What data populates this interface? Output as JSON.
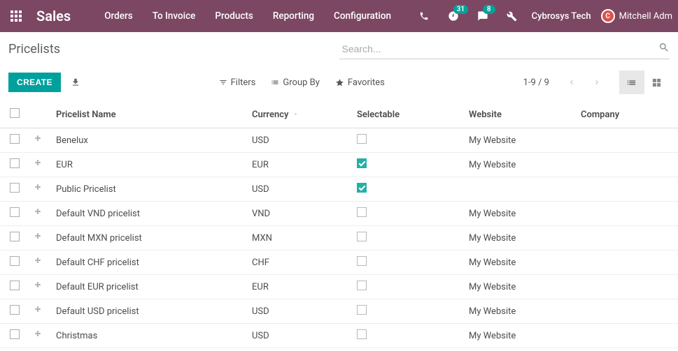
{
  "nav": {
    "brand": "Sales",
    "links": [
      "Orders",
      "To Invoice",
      "Products",
      "Reporting",
      "Configuration"
    ],
    "clock_badge": "31",
    "chat_badge": "8",
    "company": "Cybrosys Tech",
    "user": "Mitchell Adm"
  },
  "breadcrumb": "Pricelists",
  "search": {
    "placeholder": "Search..."
  },
  "buttons": {
    "create": "CREATE"
  },
  "filters": {
    "filters": "Filters",
    "groupby": "Group By",
    "favorites": "Favorites"
  },
  "pager": {
    "counter": "1-9 / 9"
  },
  "columns": {
    "name": "Pricelist Name",
    "currency": "Currency",
    "selectable": "Selectable",
    "website": "Website",
    "company": "Company"
  },
  "rows": [
    {
      "name": "Benelux",
      "currency": "USD",
      "selectable": false,
      "website": "My Website",
      "company": ""
    },
    {
      "name": "EUR",
      "currency": "EUR",
      "selectable": true,
      "website": "My Website",
      "company": ""
    },
    {
      "name": "Public Pricelist",
      "currency": "USD",
      "selectable": true,
      "website": "",
      "company": ""
    },
    {
      "name": "Default VND pricelist",
      "currency": "VND",
      "selectable": false,
      "website": "My Website",
      "company": ""
    },
    {
      "name": "Default MXN pricelist",
      "currency": "MXN",
      "selectable": false,
      "website": "My Website",
      "company": ""
    },
    {
      "name": "Default CHF pricelist",
      "currency": "CHF",
      "selectable": false,
      "website": "My Website",
      "company": ""
    },
    {
      "name": "Default EUR pricelist",
      "currency": "EUR",
      "selectable": false,
      "website": "My Website",
      "company": ""
    },
    {
      "name": "Default USD pricelist",
      "currency": "USD",
      "selectable": false,
      "website": "My Website",
      "company": ""
    },
    {
      "name": "Christmas",
      "currency": "USD",
      "selectable": false,
      "website": "My Website",
      "company": ""
    }
  ]
}
